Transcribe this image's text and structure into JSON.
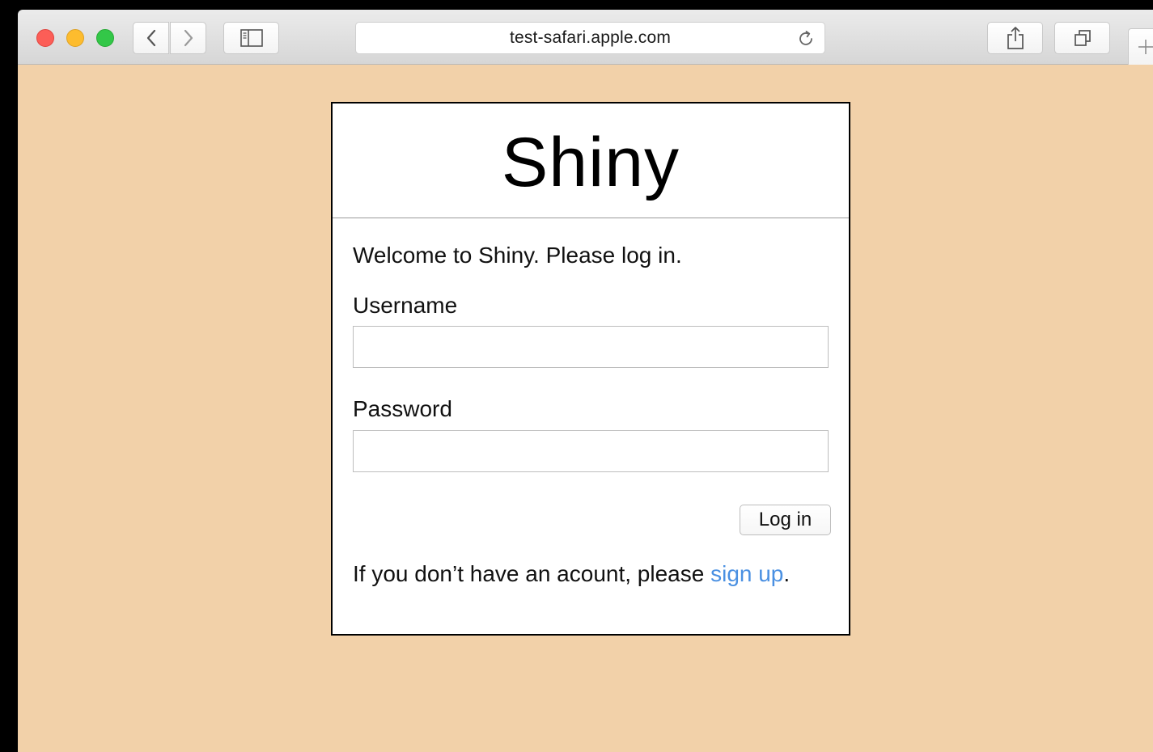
{
  "browser": {
    "url": "test-safari.apple.com",
    "icons": {
      "back": "chevron-left-icon",
      "forward": "chevron-right-icon",
      "sidebar": "sidebar-icon",
      "reload": "reload-icon",
      "share": "share-icon",
      "tabs": "tab-overview-icon",
      "new_tab": "plus-icon"
    },
    "traffic_lights": {
      "close": "#fc5e57",
      "minimize": "#fdbc2e",
      "maximize": "#33c748"
    }
  },
  "page": {
    "background_color": "#f2d1a9",
    "logo_title": "Shiny",
    "welcome_text": "Welcome to Shiny. Please log in.",
    "username": {
      "label": "Username",
      "value": "",
      "placeholder": ""
    },
    "password": {
      "label": "Password",
      "value": "",
      "placeholder": ""
    },
    "login_button_label": "Log in",
    "signup": {
      "prefix": "If you don’t have an acount, please ",
      "link_text": "sign up",
      "suffix": ".",
      "link_color": "#4a90e2"
    }
  }
}
